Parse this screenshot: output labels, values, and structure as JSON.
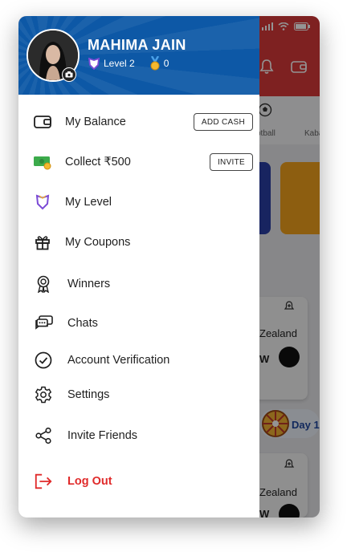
{
  "user": {
    "name": "MAHIMA JAIN",
    "level_label": "Level 2",
    "medal_count": "0"
  },
  "menu": [
    {
      "label": "My Balance",
      "action": "ADD CASH"
    },
    {
      "label": "Collect ₹500",
      "action": "INVITE"
    },
    {
      "label": "My Level"
    },
    {
      "label": "My Coupons"
    },
    {
      "label": "Winners"
    },
    {
      "label": "Chats"
    },
    {
      "label": "Account Verification"
    },
    {
      "label": "Settings"
    },
    {
      "label": "Invite Friends"
    },
    {
      "label": "Log Out"
    }
  ],
  "background": {
    "tabs": [
      "otball",
      "Kaba"
    ],
    "match_cards": [
      {
        "team": "Zealand",
        "code": "W"
      },
      {
        "team": "Zealand",
        "code": "W"
      }
    ],
    "promo": "Day 1"
  },
  "colors": {
    "header_blue": "#0d58a6",
    "app_red": "#d93a3a",
    "logout_red": "#e02a2a",
    "level_purple": "#7b4bd6"
  }
}
